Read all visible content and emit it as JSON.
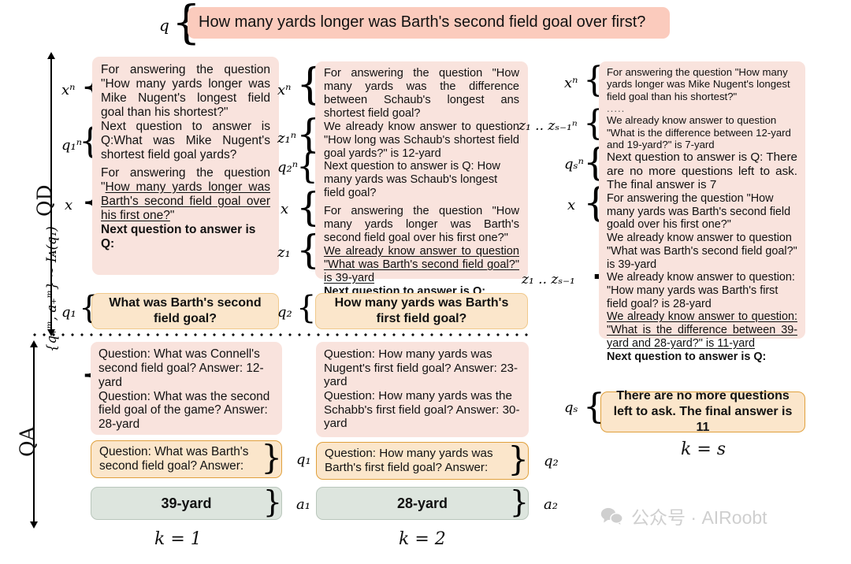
{
  "figure": {
    "title_question": "How many yards longer was Barth's second field goal over first?",
    "section_labels": {
      "qd": "QD",
      "qa": "QA"
    },
    "step_captions": {
      "k1": "k = 1",
      "k2": "k = 2",
      "ks": "k = s"
    },
    "watermark": "公众号 · AIRoobt",
    "colors": {
      "prompt_pink": "#f9e3dd",
      "question_pink": "#fbcbbd",
      "generated_orange": "#fbe6cb",
      "answer_green": "#dde5de",
      "orange_border": "#e0a03c",
      "green_border": "#b9c6bb"
    }
  },
  "top": {
    "label": "q",
    "question": "How many yards longer was Barth's second field goal over first?"
  },
  "col1": {
    "labels": {
      "xn": "xⁿ",
      "q1n": "q₁ⁿ",
      "x": "x",
      "q1": "q₁"
    },
    "prompt": {
      "p1": "For answering the question \"How many yards longer was Mike Nugent's longest field goal than his shortest?\"",
      "p2": "Next question to answer is Q:What was Mike Nugent's shortest field goal yards?",
      "p3_prefix": "For answering the question \"",
      "p3_underline": "How many yards longer was Barth's second field goal over his first one?",
      "p3_suffix": "\"",
      "p4_bold": "Next question to answer is Q:"
    },
    "generated_question": "What was Barth's second field goal?"
  },
  "col2": {
    "labels": {
      "xn": "xⁿ",
      "z1n": "z₁ⁿ",
      "q2n": "q₂ⁿ",
      "x": "x",
      "z1": "z₁",
      "q2": "q₂"
    },
    "prompt": {
      "p1": "For answering the question \"How many yards was the difference between Schaub's longest ans shortest field goal?",
      "p2": "We already know answer to question \"How long was Schaub's shortest field goal yards?\" is 12-yard",
      "p3": "Next question to answer is Q: How many yards was Schaub's longest field goal?",
      "p4": "For answering the question \"How many yards longer was Barth's second field goal over his first one?\"",
      "p5_underline": "We already know answer to question \"What was Barth's second field goal?\" is 39-yard",
      "p6_bold": "Next question to answer is Q:"
    },
    "generated_question": "How many yards was Barth's first field goal?"
  },
  "col3": {
    "labels": {
      "xn": "xⁿ",
      "z_range_n": "z₁ .. zₛ₋₁ⁿ",
      "qsn": "qₛⁿ",
      "x": "x",
      "z_range": "z₁ .. zₛ₋₁",
      "qs": "qₛ"
    },
    "prompt": {
      "p1": "For answering the question \"How many yards longer was Mike Nugent's longest field goal than his shortest?\"",
      "ellipsis": ".....",
      "p2": "We already know answer to question \"What is the difference between 12-yard and 19-yard?\" is 7-yard",
      "p3_bold": "Next question to answer is Q: There are no more questions left to ask. The final answer is 7",
      "p4": "For answering the question \"How many yards was Barth's second field goald over his first one?\"",
      "p5": "We already know answer to question \"What was Barth's second field goal?\" is 39-yard",
      "p6": "We already know answer to question: \"How many yards was Barth's first field goal? is 28-yard",
      "p7_underline": "We already know answer to question: \"What is the difference between 39-yard and 28-yard?\" is 11-yard",
      "p8_bold": "Next question to answer is Q:"
    },
    "final_answer_text": "There are no more questions left to ask. The final answer is 11"
  },
  "qa": {
    "left_label_prefix": "{q",
    "left_label_full": "{q₊ᵐ, a₊ᵐ} ~ Iᴀ(q₁)",
    "col1": {
      "examples": [
        "Question: What was Connell's second field goal? Answer: 12-yard",
        "Question: What was the second field goal of the game? Answer: 28-yard"
      ],
      "query": "Question: What was Barth's second field goal? Answer:",
      "query_label": "q₁",
      "answer": "39-yard",
      "answer_label": "a₁"
    },
    "col2": {
      "examples": [
        "Question: How many yards was Nugent's first field goal?  Answer: 23-yard",
        "Question: How many yards was the Schabb's first field goal?  Answer: 30-yard"
      ],
      "query": "Question: How many yards was Barth's first field goal? Answer:",
      "query_label": "q₂",
      "answer": "28-yard",
      "answer_label": "a₂"
    }
  }
}
